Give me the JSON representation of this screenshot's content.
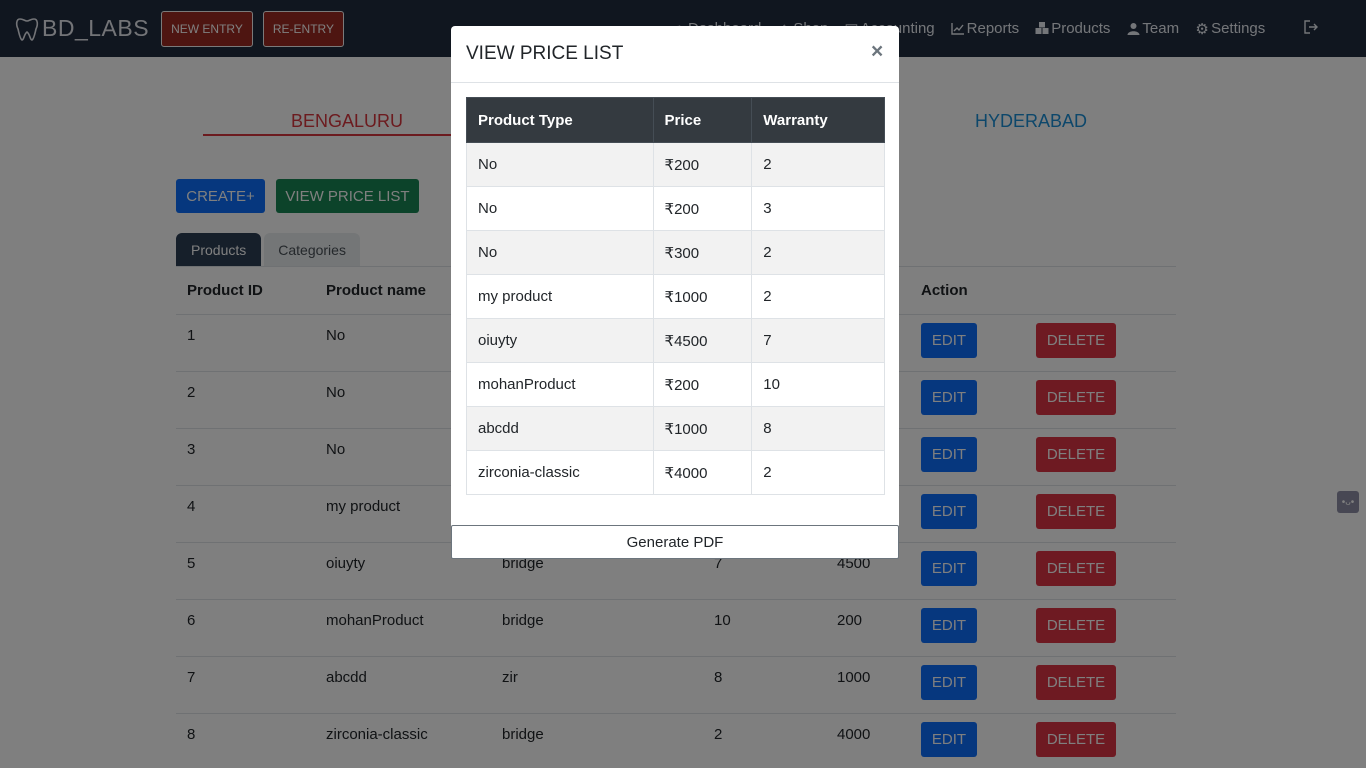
{
  "navbar": {
    "brand": "BD_LABS",
    "new_entry": "NEW ENTRY",
    "re_entry": "RE-ENTRY",
    "links": [
      {
        "label": "Dashboard",
        "icon": "gauge-icon"
      },
      {
        "label": "Shop",
        "icon": "shop-icon"
      },
      {
        "label": "Accounting",
        "icon": "accounting-icon"
      },
      {
        "label": "Reports",
        "icon": "chart-icon"
      },
      {
        "label": "Products",
        "icon": "cubes-icon"
      },
      {
        "label": "Team",
        "icon": "user-icon"
      },
      {
        "label": "Settings",
        "icon": "gear-icon"
      }
    ]
  },
  "page": {
    "city_left": "BENGALURU",
    "city_right": "HYDERABAD",
    "create_label": "CREATE+",
    "view_label": "VIEW PRICE LIST",
    "tabs": [
      "Products",
      "Categories"
    ],
    "columns": [
      "Product ID",
      "Product name",
      "",
      "",
      "",
      "Action",
      ""
    ],
    "rows": [
      {
        "id": "1",
        "name": "No",
        "cat": "",
        "warranty": "",
        "price": ""
      },
      {
        "id": "2",
        "name": "No",
        "cat": "",
        "warranty": "",
        "price": ""
      },
      {
        "id": "3",
        "name": "No",
        "cat": "",
        "warranty": "",
        "price": ""
      },
      {
        "id": "4",
        "name": "my product",
        "cat": "",
        "warranty": "",
        "price": ""
      },
      {
        "id": "5",
        "name": "oiuyty",
        "cat": "bridge",
        "warranty": "7",
        "price": "4500"
      },
      {
        "id": "6",
        "name": "mohanProduct",
        "cat": "bridge",
        "warranty": "10",
        "price": "200"
      },
      {
        "id": "7",
        "name": "abcdd",
        "cat": "zir",
        "warranty": "8",
        "price": "1000"
      },
      {
        "id": "8",
        "name": "zirconia-classic",
        "cat": "bridge",
        "warranty": "2",
        "price": "4000"
      }
    ],
    "edit_label": "EDIT",
    "delete_label": "DELETE"
  },
  "modal": {
    "title": "VIEW PRICE LIST",
    "close": "×",
    "headers": [
      "Product Type",
      "Price",
      "Warranty"
    ],
    "rows": [
      {
        "type": "No",
        "price": "₹200",
        "warranty": "2"
      },
      {
        "type": "No",
        "price": "₹200",
        "warranty": "3"
      },
      {
        "type": "No",
        "price": "₹300",
        "warranty": "2"
      },
      {
        "type": "my product",
        "price": "₹1000",
        "warranty": "2"
      },
      {
        "type": "oiuyty",
        "price": "₹4500",
        "warranty": "7"
      },
      {
        "type": "mohanProduct",
        "price": "₹200",
        "warranty": "10"
      },
      {
        "type": "abcdd",
        "price": "₹1000",
        "warranty": "8"
      },
      {
        "type": "zirconia-classic",
        "price": "₹4000",
        "warranty": "2"
      }
    ],
    "generate_pdf": "Generate PDF"
  }
}
